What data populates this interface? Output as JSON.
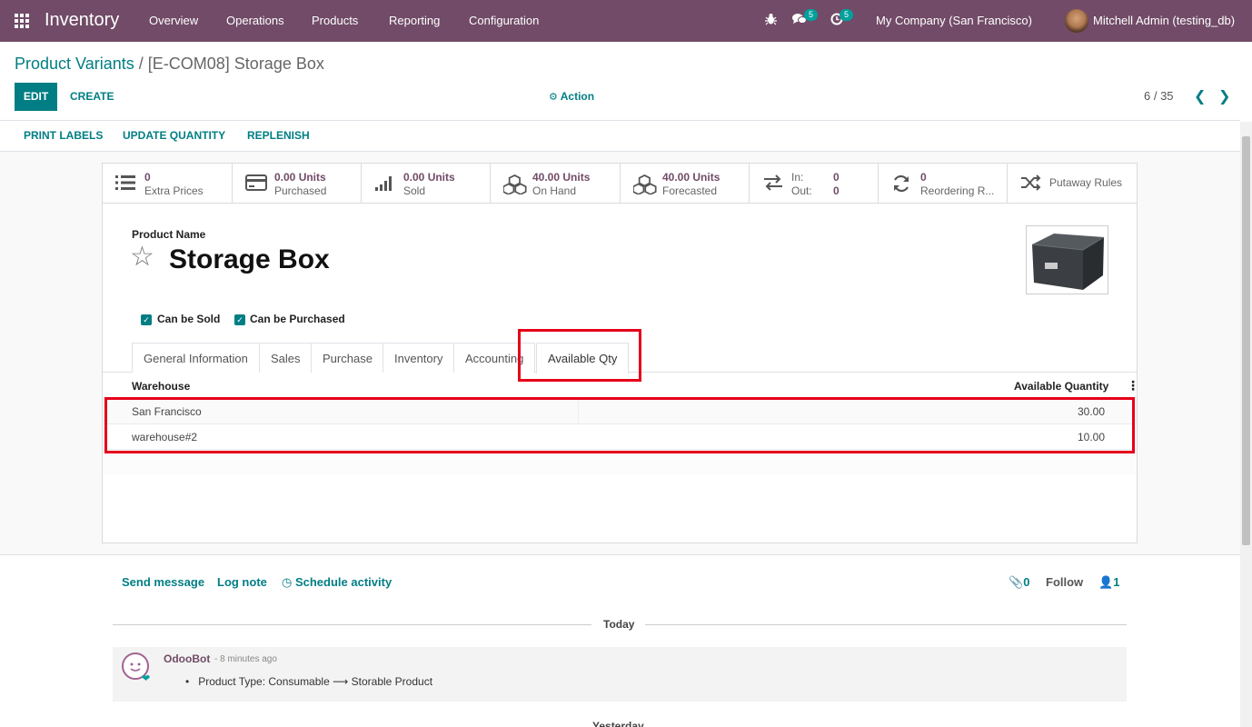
{
  "navbar": {
    "app_name": "Inventory",
    "menu": [
      "Overview",
      "Operations",
      "Products",
      "Reporting",
      "Configuration"
    ],
    "chat_badge": "5",
    "activity_badge": "5",
    "company": "My Company (San Francisco)",
    "user": "Mitchell Admin (testing_db)"
  },
  "breadcrumb": {
    "parent": "Product Variants",
    "separator": "/",
    "current": "[E-COM08] Storage Box"
  },
  "buttons": {
    "edit": "EDIT",
    "create": "CREATE",
    "action": "Action",
    "print_labels": "PRINT LABELS",
    "update_quantity": "UPDATE QUANTITY",
    "replenish": "REPLENISH"
  },
  "pager": {
    "value": "6 / 35"
  },
  "stats": {
    "extra_prices": {
      "v1": "0",
      "v2": "Extra Prices"
    },
    "purchased": {
      "v1": "0.00 Units",
      "v2": "Purchased"
    },
    "sold": {
      "v1": "0.00 Units",
      "v2": "Sold"
    },
    "on_hand": {
      "v1": "40.00 Units",
      "v2": "On Hand"
    },
    "forecasted": {
      "v1": "40.00 Units",
      "v2": "Forecasted"
    },
    "in_out": {
      "in_label": "In:",
      "in_value": "0",
      "out_label": "Out:",
      "out_value": "0"
    },
    "reordering": {
      "v1": "0",
      "v2": "Reordering R..."
    },
    "putaway": {
      "label": "Putaway Rules"
    }
  },
  "product": {
    "name_label": "Product Name",
    "name": "Storage Box",
    "can_be_sold": "Can be Sold",
    "can_be_purchased": "Can be Purchased"
  },
  "tabs": [
    "General Information",
    "Sales",
    "Purchase",
    "Inventory",
    "Accounting",
    "Available Qty"
  ],
  "table": {
    "headers": {
      "warehouse": "Warehouse",
      "qty": "Available Quantity"
    },
    "rows": [
      {
        "warehouse": "San Francisco",
        "qty": "30.00"
      },
      {
        "warehouse": "warehouse#2",
        "qty": "10.00"
      }
    ]
  },
  "chatter": {
    "send_message": "Send message",
    "log_note": "Log note",
    "schedule_activity": "Schedule activity",
    "attachments": "0",
    "follow": "Follow",
    "followers": "1",
    "today": "Today",
    "message": {
      "author": "OdooBot",
      "time": "- 8 minutes ago",
      "body_from": "Product Type: Consumable",
      "body_to": "Storable Product"
    },
    "yesterday": "Yesterday"
  },
  "colors": {
    "navbar": "#714B67",
    "accent": "#017e84",
    "highlight": "#e5001a"
  }
}
